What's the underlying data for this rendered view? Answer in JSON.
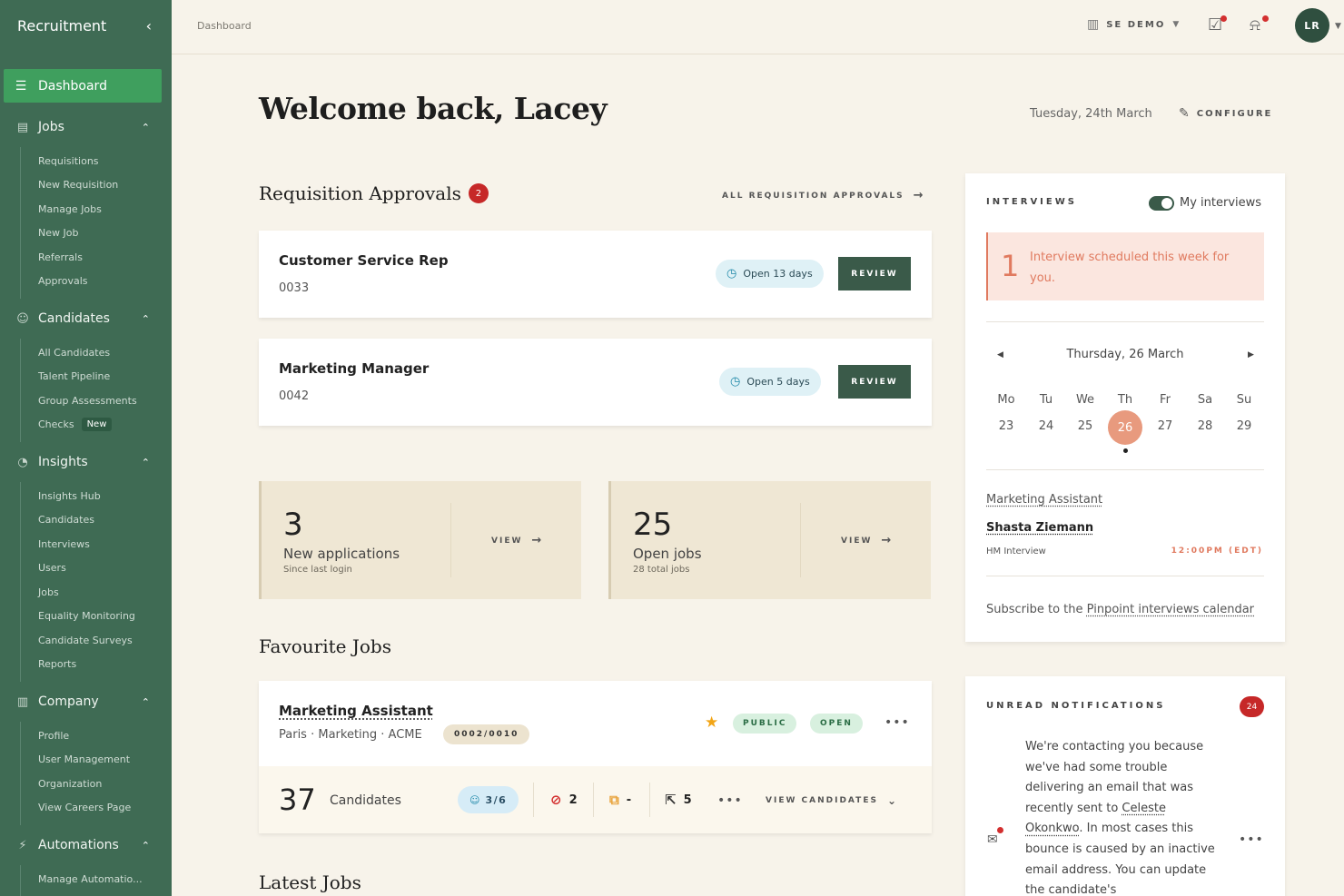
{
  "sidebar": {
    "title": "Recruitment",
    "collapse_icon": "chevron-left-icon",
    "active": {
      "label": "Dashboard",
      "icon": "dashboard-icon"
    },
    "groups": [
      {
        "label": "Jobs",
        "icon": "briefcase-icon",
        "items": [
          "Requisitions",
          "New Requisition",
          "Manage Jobs",
          "New Job",
          "Referrals",
          "Approvals"
        ]
      },
      {
        "label": "Candidates",
        "icon": "users-icon",
        "items": [
          "All Candidates",
          "Talent Pipeline",
          "Group Assessments",
          "Checks"
        ],
        "checks_badge": "New"
      },
      {
        "label": "Insights",
        "icon": "pie-chart-icon",
        "items": [
          "Insights Hub",
          "Candidates",
          "Interviews",
          "Users",
          "Jobs",
          "Equality Monitoring",
          "Candidate Surveys",
          "Reports"
        ]
      },
      {
        "label": "Company",
        "icon": "building-icon",
        "items": [
          "Profile",
          "User Management",
          "Organization",
          "View Careers Page"
        ]
      },
      {
        "label": "Automations",
        "icon": "bolt-icon",
        "items": [
          "Manage Automatio..."
        ]
      }
    ]
  },
  "topbar": {
    "breadcrumb": "Dashboard",
    "org": "SE DEMO",
    "avatar": "LR"
  },
  "main": {
    "welcome": "Welcome back, Lacey",
    "date": "Tuesday, 24th March",
    "configure": "CONFIGURE",
    "approvals": {
      "title": "Requisition Approvals",
      "count": "2",
      "all_link": "ALL REQUISITION APPROVALS",
      "items": [
        {
          "title": "Customer Service Rep",
          "number": "0033",
          "open": "Open 13 days",
          "action": "REVIEW"
        },
        {
          "title": "Marketing Manager",
          "number": "0042",
          "open": "Open 5 days",
          "action": "REVIEW"
        }
      ]
    },
    "stats": [
      {
        "value": "3",
        "label": "New applications",
        "sub": "Since last login",
        "action": "VIEW"
      },
      {
        "value": "25",
        "label": "Open jobs",
        "sub": "28 total jobs",
        "action": "VIEW"
      }
    ],
    "favourites": {
      "title": "Favourite Jobs",
      "job": {
        "title": "Marketing Assistant",
        "meta": "Paris · Marketing · ACME",
        "code": "0002/0010",
        "badge_public": "PUBLIC",
        "badge_open": "OPEN",
        "candidates_count": "37",
        "candidates_label": "Candidates",
        "ratio": "3/6",
        "rejected": "2",
        "pending": "-",
        "moved": "5",
        "view_candidates": "VIEW CANDIDATES"
      }
    },
    "latest_title": "Latest Jobs"
  },
  "interviews": {
    "title": "INTERVIEWS",
    "toggle_label": "My interviews",
    "alert_count": "1",
    "alert_text": "Interview scheduled this week for you.",
    "calendar": {
      "heading": "Thursday, 26 March",
      "days": [
        "Mo",
        "Tu",
        "We",
        "Th",
        "Fr",
        "Sa",
        "Su"
      ],
      "dates": [
        "23",
        "24",
        "25",
        "26",
        "27",
        "28",
        "29"
      ],
      "selected": "26"
    },
    "item": {
      "job": "Marketing Assistant",
      "candidate": "Shasta Ziemann",
      "type": "HM Interview",
      "time": "12:00PM (EDT)"
    },
    "subscribe_prefix": "Subscribe to the ",
    "subscribe_link": "Pinpoint interviews calendar"
  },
  "notifications": {
    "title": "UNREAD NOTIFICATIONS",
    "count": "24",
    "text_before": "We're contacting you because we've had some trouble delivering an email that was recently sent to ",
    "text_link": "Celeste Okonkwo",
    "text_after": ". In most cases this bounce is caused by an inactive email address. You can update the candidate's"
  }
}
